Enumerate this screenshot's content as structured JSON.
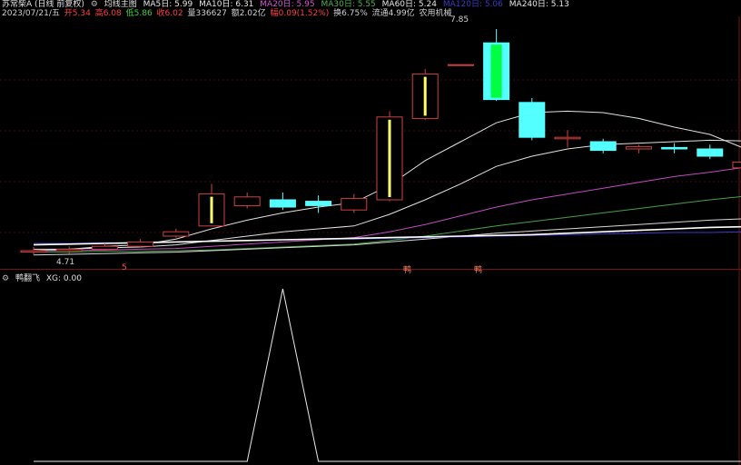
{
  "header": {
    "title": "苏常柴A (日线 前复权)",
    "indicator": "均线主图",
    "ma": [
      {
        "label": "MA5日: 5.99",
        "color": "#e6e6e6"
      },
      {
        "label": "MA10日: 6.31",
        "color": "#e6e6e6"
      },
      {
        "label": "MA20日: 5.95",
        "color": "#d257d2"
      },
      {
        "label": "MA30日: 5.55",
        "color": "#4fb04f"
      },
      {
        "label": "MA60日: 5.24",
        "color": "#e6e6e6"
      },
      {
        "label": "MA120日: 5.06",
        "color": "#3a3acc"
      },
      {
        "label": "MA240日: 5.13",
        "color": "#e6e6e6"
      }
    ]
  },
  "info": {
    "date": "2023/07/21/五",
    "open": "开5.34",
    "high": "高6.08",
    "low": "低5.86",
    "close": "收6.02",
    "volume": "量336627",
    "amount": "额2.02亿",
    "change": "幅0.09(1.52%)",
    "turnover": "换6.75%",
    "float": "流通4.99亿",
    "industry": "农用机械"
  },
  "price_labels": {
    "high": "7.85",
    "low": "4.71"
  },
  "signals": [
    "5",
    "鸭",
    "鸭"
  ],
  "sub_indicator": {
    "name": "鸭翻飞",
    "value": "XG: 0.00"
  },
  "chart_data": {
    "type": "candlestick",
    "candles": [
      {
        "open": 4.78,
        "close": 4.8,
        "high": 4.85,
        "low": 4.74
      },
      {
        "open": 4.8,
        "close": 4.82,
        "high": 4.86,
        "low": 4.76
      },
      {
        "open": 4.82,
        "close": 4.86,
        "high": 4.9,
        "low": 4.8
      },
      {
        "open": 4.86,
        "close": 4.92,
        "high": 4.96,
        "low": 4.84
      },
      {
        "open": 5.0,
        "close": 5.06,
        "high": 5.1,
        "low": 4.98
      },
      {
        "open": 5.14,
        "close": 5.58,
        "high": 5.72,
        "low": 5.14
      },
      {
        "open": 5.42,
        "close": 5.54,
        "high": 5.6,
        "low": 5.38
      },
      {
        "open": 5.5,
        "close": 5.4,
        "high": 5.6,
        "low": 5.36
      },
      {
        "open": 5.48,
        "close": 5.42,
        "high": 5.56,
        "low": 5.32
      },
      {
        "open": 5.36,
        "close": 5.52,
        "high": 5.58,
        "low": 5.32
      },
      {
        "open": 5.5,
        "close": 6.64,
        "high": 6.72,
        "low": 5.48
      },
      {
        "open": 6.62,
        "close": 7.23,
        "high": 7.3,
        "low": 6.6
      },
      {
        "open": 7.36,
        "close": 7.36,
        "high": 7.36,
        "low": 7.36
      },
      {
        "open": 7.66,
        "close": 6.88,
        "high": 7.85,
        "low": 6.86
      },
      {
        "open": 6.84,
        "close": 6.36,
        "high": 6.9,
        "low": 6.32
      },
      {
        "open": 6.34,
        "close": 6.36,
        "high": 6.46,
        "low": 6.22
      },
      {
        "open": 6.3,
        "close": 6.18,
        "high": 6.34,
        "low": 6.14
      },
      {
        "open": 6.2,
        "close": 6.23,
        "high": 6.26,
        "low": 6.14
      },
      {
        "open": 6.22,
        "close": 6.2,
        "high": 6.28,
        "low": 6.14
      },
      {
        "open": 6.2,
        "close": 6.1,
        "high": 6.26,
        "low": 6.06
      },
      {
        "open": 5.94,
        "close": 6.02,
        "high": 6.08,
        "low": 5.86
      }
    ],
    "ma_lines": [
      {
        "name": "MA5",
        "color": "#e0e0e0",
        "values": [
          4.8,
          4.82,
          4.86,
          4.88,
          4.96,
          5.1,
          5.22,
          5.32,
          5.4,
          5.46,
          5.7,
          6.04,
          6.3,
          6.56,
          6.7,
          6.72,
          6.7,
          6.62,
          6.5,
          6.4,
          6.2
        ]
      },
      {
        "name": "MA10",
        "color": "#e0e0e0",
        "values": [
          4.82,
          4.82,
          4.84,
          4.85,
          4.88,
          4.94,
          5.0,
          5.06,
          5.1,
          5.14,
          5.3,
          5.5,
          5.72,
          5.96,
          6.1,
          6.2,
          6.26,
          6.28,
          6.3,
          6.32,
          6.31
        ]
      },
      {
        "name": "MA20",
        "color": "#c04cc0",
        "values": [
          4.8,
          4.8,
          4.81,
          4.82,
          4.83,
          4.86,
          4.89,
          4.92,
          4.95,
          4.98,
          5.06,
          5.16,
          5.28,
          5.4,
          5.5,
          5.58,
          5.66,
          5.74,
          5.82,
          5.88,
          5.95
        ]
      },
      {
        "name": "MA30",
        "color": "#46a046",
        "values": [
          4.78,
          4.78,
          4.79,
          4.79,
          4.8,
          4.81,
          4.83,
          4.85,
          4.87,
          4.89,
          4.94,
          5.0,
          5.07,
          5.14,
          5.2,
          5.26,
          5.32,
          5.38,
          5.44,
          5.5,
          5.55
        ]
      },
      {
        "name": "MA60",
        "color": "#d8d8d8",
        "values": [
          4.74,
          4.75,
          4.76,
          4.77,
          4.78,
          4.8,
          4.82,
          4.84,
          4.86,
          4.88,
          4.92,
          4.96,
          5.0,
          5.04,
          5.07,
          5.1,
          5.13,
          5.16,
          5.19,
          5.22,
          5.24
        ]
      },
      {
        "name": "MA120",
        "color": "#3a3acc",
        "values": [
          4.9,
          4.9,
          4.91,
          4.91,
          4.92,
          4.93,
          4.94,
          4.95,
          4.96,
          4.96,
          4.97,
          4.98,
          4.99,
          5.0,
          5.01,
          5.02,
          5.03,
          5.04,
          5.05,
          5.05,
          5.06
        ]
      },
      {
        "name": "MA240",
        "color": "#ffffff",
        "values": [
          4.88,
          4.89,
          4.9,
          4.91,
          4.92,
          4.93,
          4.94,
          4.95,
          4.96,
          4.97,
          4.98,
          4.99,
          5.0,
          5.01,
          5.02,
          5.04,
          5.06,
          5.08,
          5.1,
          5.12,
          5.13
        ]
      }
    ],
    "xg_values": [
      0,
      0,
      0,
      0,
      0,
      0,
      0,
      1,
      0,
      0,
      0,
      0,
      0,
      0,
      0,
      0,
      0,
      0,
      0,
      0,
      0
    ],
    "ylim": [
      4.6,
      7.95
    ]
  }
}
